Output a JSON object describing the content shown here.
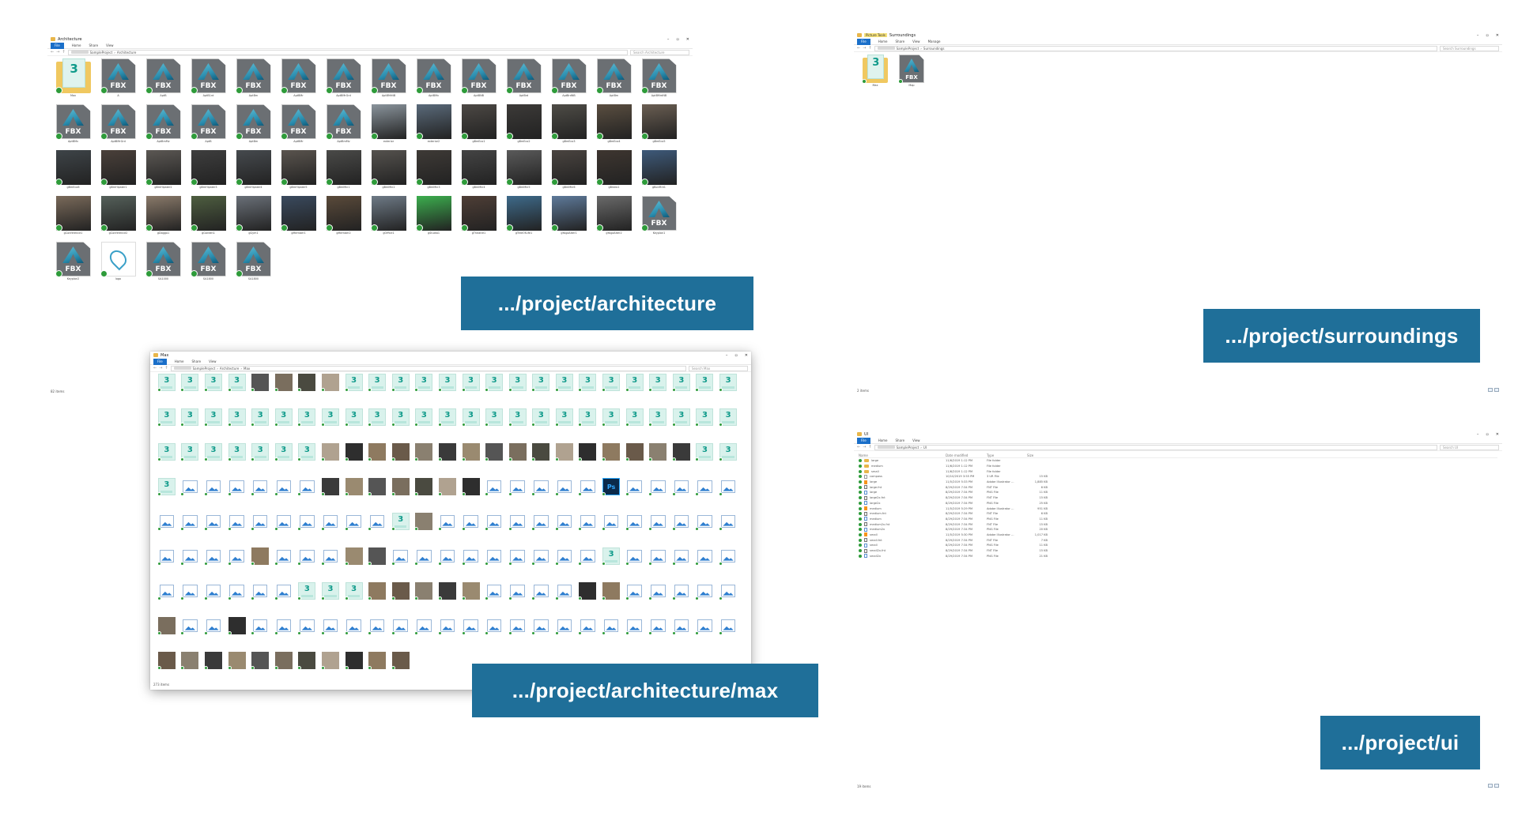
{
  "colors": {
    "label_bg": "#1f6f99",
    "ribbon_file": "#1a6fc9",
    "check": "#2e9b3a",
    "folder": "#e8b64a"
  },
  "labels": {
    "architecture": ".../project/architecture",
    "surroundings": ".../project/surroundings",
    "max": ".../project/architecture/max",
    "ui": ".../project/ui"
  },
  "win_arch": {
    "title": "Architecture",
    "ribbon": [
      "File",
      "Home",
      "Share",
      "View"
    ],
    "path": [
      "SampleProject",
      "Architecture"
    ],
    "search": "Search Architecture",
    "status": "82 items",
    "items": [
      {
        "t": "folder-max",
        "n": "Max"
      },
      {
        "t": "fbx",
        "n": "A"
      },
      {
        "t": "fbx",
        "n": "AptB"
      },
      {
        "t": "fbx",
        "n": "AptB1rd"
      },
      {
        "t": "fbx",
        "n": "AptBm"
      },
      {
        "t": "fbx",
        "n": "AptBMr"
      },
      {
        "t": "fbx",
        "n": "AptBMrGrd"
      },
      {
        "t": "fbx",
        "n": "AptBMrNB"
      },
      {
        "t": "fbx",
        "n": "AptBMv"
      },
      {
        "t": "fbx",
        "n": "AptBNB"
      },
      {
        "t": "fbx",
        "n": "AptBrd"
      },
      {
        "t": "fbx",
        "n": "AptBrdNB"
      },
      {
        "t": "fbx",
        "n": "AptBm"
      },
      {
        "t": "fbx",
        "n": "AptBMrdNB"
      },
      {
        "t": "fbx",
        "n": "AptBMv"
      },
      {
        "t": "fbx",
        "n": "AptBMrGrd"
      },
      {
        "t": "fbx",
        "n": "AptBmMv"
      },
      {
        "t": "fbx",
        "n": "AptB"
      },
      {
        "t": "fbx",
        "n": "AptBm"
      },
      {
        "t": "fbx",
        "n": "AptBMr"
      },
      {
        "t": "fbx",
        "n": "AptBmMv"
      },
      {
        "t": "photo",
        "n": "exterior",
        "c": "#8a949c"
      },
      {
        "t": "photo",
        "n": "exterior2",
        "c": "#5a6a7a"
      },
      {
        "t": "photo",
        "n": "gBmEco1",
        "c": "#4c4844"
      },
      {
        "t": "photo",
        "n": "gBmEco2",
        "c": "#3c3a38"
      },
      {
        "t": "photo",
        "n": "gBmEco3",
        "c": "#4e4c46"
      },
      {
        "t": "photo",
        "n": "gBmEco4",
        "c": "#5a4e40"
      },
      {
        "t": "photo",
        "n": "gBmEco5",
        "c": "#6a5e52"
      },
      {
        "t": "photo",
        "n": "gBmEco6",
        "c": "#3e4448"
      },
      {
        "t": "photo",
        "n": "gBmHipster1",
        "c": "#4a403a"
      },
      {
        "t": "photo",
        "n": "gBmHipster2",
        "c": "#5c5854"
      },
      {
        "t": "photo",
        "n": "gBmHipster3",
        "c": "#3e3e3e"
      },
      {
        "t": "photo",
        "n": "gBmHipster4",
        "c": "#464a4e"
      },
      {
        "t": "photo",
        "n": "gBmHipster5",
        "c": "#5a544e"
      },
      {
        "t": "photo",
        "n": "gBmMin1",
        "c": "#4a4a48"
      },
      {
        "t": "photo",
        "n": "gBmMin2",
        "c": "#55524e"
      },
      {
        "t": "photo",
        "n": "gBmMin3",
        "c": "#3e3a36"
      },
      {
        "t": "photo",
        "n": "gBmMin4",
        "c": "#444"
      },
      {
        "t": "photo",
        "n": "gBmMin5",
        "c": "#5a5a5a"
      },
      {
        "t": "photo",
        "n": "gBmMin6",
        "c": "#4a4440"
      },
      {
        "t": "photo",
        "n": "gBistro1",
        "c": "#3e3630"
      },
      {
        "t": "photo",
        "n": "gBonFire1",
        "c": "#3e5a7a"
      },
      {
        "t": "photo",
        "n": "gConference1",
        "c": "#7a6a5a"
      },
      {
        "t": "photo",
        "n": "gConference2",
        "c": "#55605a"
      },
      {
        "t": "photo",
        "n": "gDoggo1",
        "c": "#8a7a6a"
      },
      {
        "t": "photo",
        "n": "gGarden1",
        "c": "#4e5e40"
      },
      {
        "t": "photo",
        "n": "gGym1",
        "c": "#6a7078"
      },
      {
        "t": "photo",
        "n": "gMember1",
        "c": "#3a4a5e"
      },
      {
        "t": "photo",
        "n": "gMember2",
        "c": "#5a4a3a"
      },
      {
        "t": "photo",
        "n": "gOffice1",
        "c": "#6e7a86"
      },
      {
        "t": "photo",
        "n": "gStudio1",
        "c": "#3cae4e"
      },
      {
        "t": "photo",
        "n": "gTheatre1",
        "c": "#4e3e36"
      },
      {
        "t": "photo",
        "n": "gTreeOfLife1",
        "c": "#3e6a8a"
      },
      {
        "t": "photo",
        "n": "gYogaAlter1",
        "c": "#5e7a9a"
      },
      {
        "t": "photo",
        "n": "gYogaAlter2",
        "c": "#6a6a6a"
      },
      {
        "t": "fbx",
        "n": "Keyplan1"
      },
      {
        "t": "fbx",
        "n": "Keyplan2"
      },
      {
        "t": "logo",
        "n": "logo"
      },
      {
        "t": "fbx",
        "n": "SA1000"
      },
      {
        "t": "fbx",
        "n": "SA1800"
      },
      {
        "t": "fbx",
        "n": "SA1800"
      }
    ]
  },
  "win_surr": {
    "title": "Surroundings",
    "context_tab": "Picture Tools",
    "ribbon": [
      "File",
      "Home",
      "Share",
      "View",
      "Manage"
    ],
    "path": [
      "SampleProject",
      "Surroundings"
    ],
    "search": "Search Surroundings",
    "status": "2 items",
    "items": [
      {
        "t": "folder-max",
        "n": "Max"
      },
      {
        "t": "fbx",
        "n": "Map"
      }
    ]
  },
  "win_max": {
    "title": "Max",
    "ribbon": [
      "File",
      "Home",
      "Share",
      "View"
    ],
    "path": [
      "SampleProject",
      "Architecture",
      "Max"
    ],
    "search": "Search Max",
    "status": "273 items"
  },
  "win_ui": {
    "title": "UI",
    "ribbon": [
      "File",
      "Home",
      "Share",
      "View"
    ],
    "path": [
      "SampleProject",
      "UI"
    ],
    "search": "Search UI",
    "status": "19 items",
    "columns": [
      "Name",
      "Date modified",
      "Type",
      "Size"
    ],
    "rows": [
      {
        "i": "folder",
        "n": "large",
        "d": "11/6/2019 1:12 PM",
        "t": "File folder",
        "s": ""
      },
      {
        "i": "folder",
        "n": "medium",
        "d": "11/6/2019 1:12 PM",
        "t": "File folder",
        "s": ""
      },
      {
        "i": "folder",
        "n": "small",
        "d": "11/6/2019 1:12 PM",
        "t": "File folder",
        "s": ""
      },
      {
        "i": "file",
        "n": "compass",
        "d": "10/10/2019 3:55 PM",
        "t": "3 UR File",
        "s": "15 KB"
      },
      {
        "i": "ai",
        "n": "large",
        "d": "11/5/2019 5:33 PM",
        "t": "Adobe Illustrator ...",
        "s": "1,885 KB"
      },
      {
        "i": "fnt",
        "n": "large.fnt",
        "d": "8/29/2019 7:34 PM",
        "t": "FNT File",
        "s": "6 KB"
      },
      {
        "i": "png",
        "n": "large",
        "d": "8/29/2019 7:34 PM",
        "t": "PNG File",
        "s": "11 KB"
      },
      {
        "i": "fnt",
        "n": "large2x.fnt",
        "d": "8/29/2019 7:34 PM",
        "t": "FNT File",
        "s": "15 KB"
      },
      {
        "i": "png",
        "n": "large2x",
        "d": "8/29/2019 7:34 PM",
        "t": "PNG File",
        "s": "25 KB"
      },
      {
        "i": "ai",
        "n": "medium",
        "d": "11/5/2019 5:29 PM",
        "t": "Adobe Illustrator ...",
        "s": "951 KB"
      },
      {
        "i": "fnt",
        "n": "medium.fnt",
        "d": "8/29/2019 7:34 PM",
        "t": "FNT File",
        "s": "6 KB"
      },
      {
        "i": "png",
        "n": "medium",
        "d": "8/29/2019 7:34 PM",
        "t": "PNG File",
        "s": "11 KB"
      },
      {
        "i": "fnt",
        "n": "medium2x.fnt",
        "d": "8/29/2019 7:34 PM",
        "t": "FNT File",
        "s": "15 KB"
      },
      {
        "i": "png",
        "n": "medium2x",
        "d": "8/29/2019 7:34 PM",
        "t": "PNG File",
        "s": "20 KB"
      },
      {
        "i": "ai",
        "n": "small",
        "d": "11/5/2019 5:30 PM",
        "t": "Adobe Illustrator ...",
        "s": "1,017 KB"
      },
      {
        "i": "fnt",
        "n": "small.fnt",
        "d": "8/29/2019 7:34 PM",
        "t": "FNT File",
        "s": "7 KB"
      },
      {
        "i": "png",
        "n": "small",
        "d": "8/29/2019 7:34 PM",
        "t": "PNG File",
        "s": "11 KB"
      },
      {
        "i": "fnt",
        "n": "small2x.fnt",
        "d": "8/29/2019 7:34 PM",
        "t": "FNT File",
        "s": "15 KB"
      },
      {
        "i": "png",
        "n": "small2x",
        "d": "8/29/2019 7:34 PM",
        "t": "PNG File",
        "s": "21 KB"
      }
    ]
  }
}
